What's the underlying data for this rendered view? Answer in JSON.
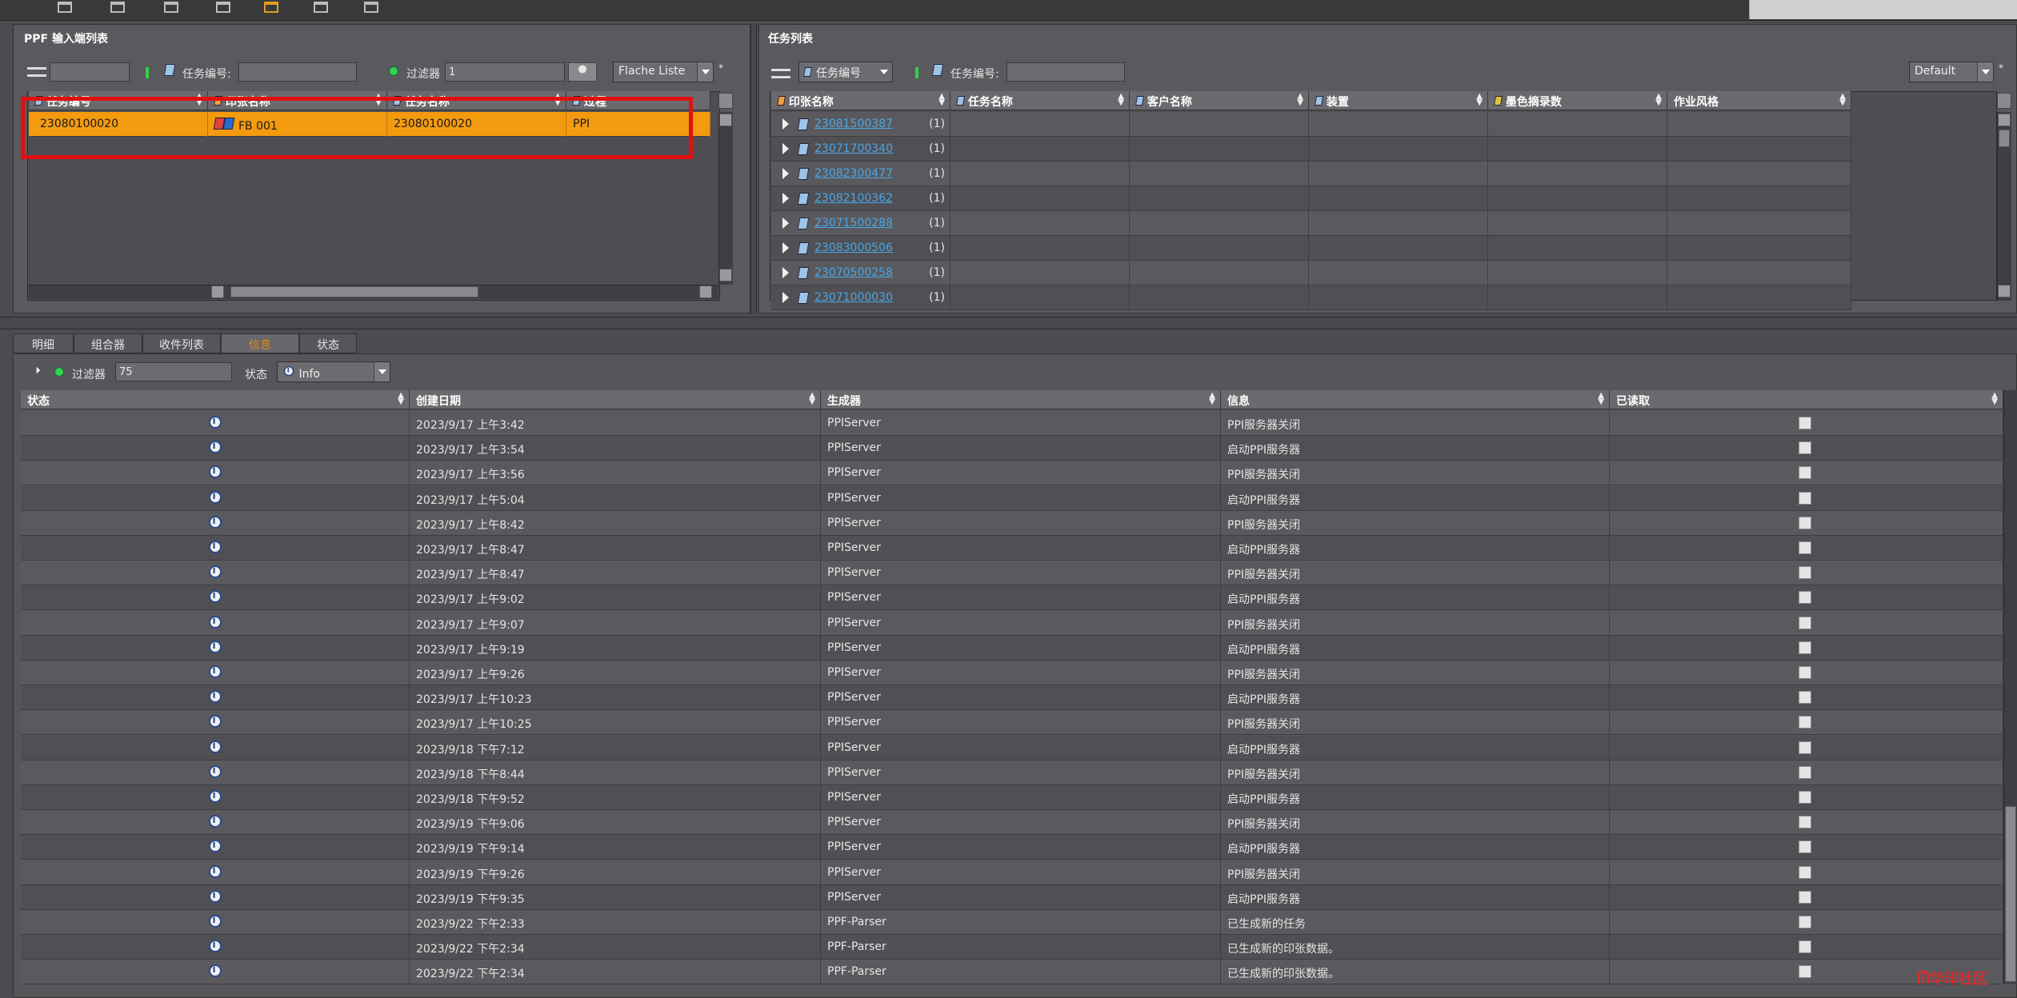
{
  "left_panel": {
    "title": "PPF 输入端列表",
    "task_no_label": "任务编号:",
    "task_no_value": "",
    "filter_label": "过滤器",
    "filter_value": "1",
    "view_select": "Flache Liste",
    "columns": [
      "任务编号",
      "印张名称",
      "任务名称",
      "过程"
    ],
    "rows": [
      {
        "task_no": "23080100020",
        "sheet": "FB 001",
        "job_name": "23080100020",
        "process": "PPI"
      }
    ]
  },
  "right_panel": {
    "title": "任务列表",
    "group_select": "任务编号",
    "task_no_label": "任务编号:",
    "task_no_value": "",
    "view_select": "Default",
    "columns": [
      "印张名称",
      "任务名称",
      "客户名称",
      "装置",
      "墨色摘录数",
      "作业风格"
    ],
    "rows": [
      {
        "id": "23081500387",
        "count": "(1)"
      },
      {
        "id": "23071700340",
        "count": "(1)"
      },
      {
        "id": "23082300477",
        "count": "(1)"
      },
      {
        "id": "23082100362",
        "count": "(1)"
      },
      {
        "id": "23071500288",
        "count": "(1)"
      },
      {
        "id": "23083000506",
        "count": "(1)"
      },
      {
        "id": "23070500258",
        "count": "(1)"
      },
      {
        "id": "23071000030",
        "count": "(1)"
      }
    ]
  },
  "bottom": {
    "tabs": [
      "明细",
      "组合器",
      "收件列表",
      "信息",
      "状态"
    ],
    "active_tab": 3,
    "filter_label": "过滤器",
    "filter_value": "75",
    "state_label": "状态",
    "state_select": "Info",
    "columns": [
      "状态",
      "创建日期",
      "生成器",
      "信息",
      "已读取"
    ],
    "rows": [
      {
        "date": "2023/9/17 上午3:42",
        "gen": "PPIServer",
        "msg": "PPI服务器关闭"
      },
      {
        "date": "2023/9/17 上午3:54",
        "gen": "PPIServer",
        "msg": "启动PPI服务器"
      },
      {
        "date": "2023/9/17 上午3:56",
        "gen": "PPIServer",
        "msg": "PPI服务器关闭"
      },
      {
        "date": "2023/9/17 上午5:04",
        "gen": "PPIServer",
        "msg": "启动PPI服务器"
      },
      {
        "date": "2023/9/17 上午8:42",
        "gen": "PPIServer",
        "msg": "PPI服务器关闭"
      },
      {
        "date": "2023/9/17 上午8:47",
        "gen": "PPIServer",
        "msg": "启动PPI服务器"
      },
      {
        "date": "2023/9/17 上午8:47",
        "gen": "PPIServer",
        "msg": "PPI服务器关闭"
      },
      {
        "date": "2023/9/17 上午9:02",
        "gen": "PPIServer",
        "msg": "启动PPI服务器"
      },
      {
        "date": "2023/9/17 上午9:07",
        "gen": "PPIServer",
        "msg": "PPI服务器关闭"
      },
      {
        "date": "2023/9/17 上午9:19",
        "gen": "PPIServer",
        "msg": "启动PPI服务器"
      },
      {
        "date": "2023/9/17 上午9:26",
        "gen": "PPIServer",
        "msg": "PPI服务器关闭"
      },
      {
        "date": "2023/9/17 上午10:23",
        "gen": "PPIServer",
        "msg": "启动PPI服务器"
      },
      {
        "date": "2023/9/17 上午10:25",
        "gen": "PPIServer",
        "msg": "PPI服务器关闭"
      },
      {
        "date": "2023/9/18 下午7:12",
        "gen": "PPIServer",
        "msg": "启动PPI服务器"
      },
      {
        "date": "2023/9/18 下午8:44",
        "gen": "PPIServer",
        "msg": "PPI服务器关闭"
      },
      {
        "date": "2023/9/18 下午9:52",
        "gen": "PPIServer",
        "msg": "启动PPI服务器"
      },
      {
        "date": "2023/9/19 下午9:06",
        "gen": "PPIServer",
        "msg": "PPI服务器关闭"
      },
      {
        "date": "2023/9/19 下午9:14",
        "gen": "PPIServer",
        "msg": "启动PPI服务器"
      },
      {
        "date": "2023/9/19 下午9:26",
        "gen": "PPIServer",
        "msg": "PPI服务器关闭"
      },
      {
        "date": "2023/9/19 下午9:35",
        "gen": "PPIServer",
        "msg": "启动PPI服务器"
      },
      {
        "date": "2023/9/22 下午2:33",
        "gen": "PPF-Parser",
        "msg": "已生成新的任务"
      },
      {
        "date": "2023/9/22 下午2:34",
        "gen": "PPF-Parser",
        "msg": "已生成新的印张数据。"
      },
      {
        "date": "2023/9/22 下午2:34",
        "gen": "PPF-Parser",
        "msg": "已生成新的印张数据。"
      }
    ]
  },
  "watermark": "华印社区",
  "colors": {
    "selected_row": "#f39a0e",
    "highlight_box": "#e01010",
    "link": "#4aa6e6",
    "active_tab_text": "#e08a1a"
  }
}
